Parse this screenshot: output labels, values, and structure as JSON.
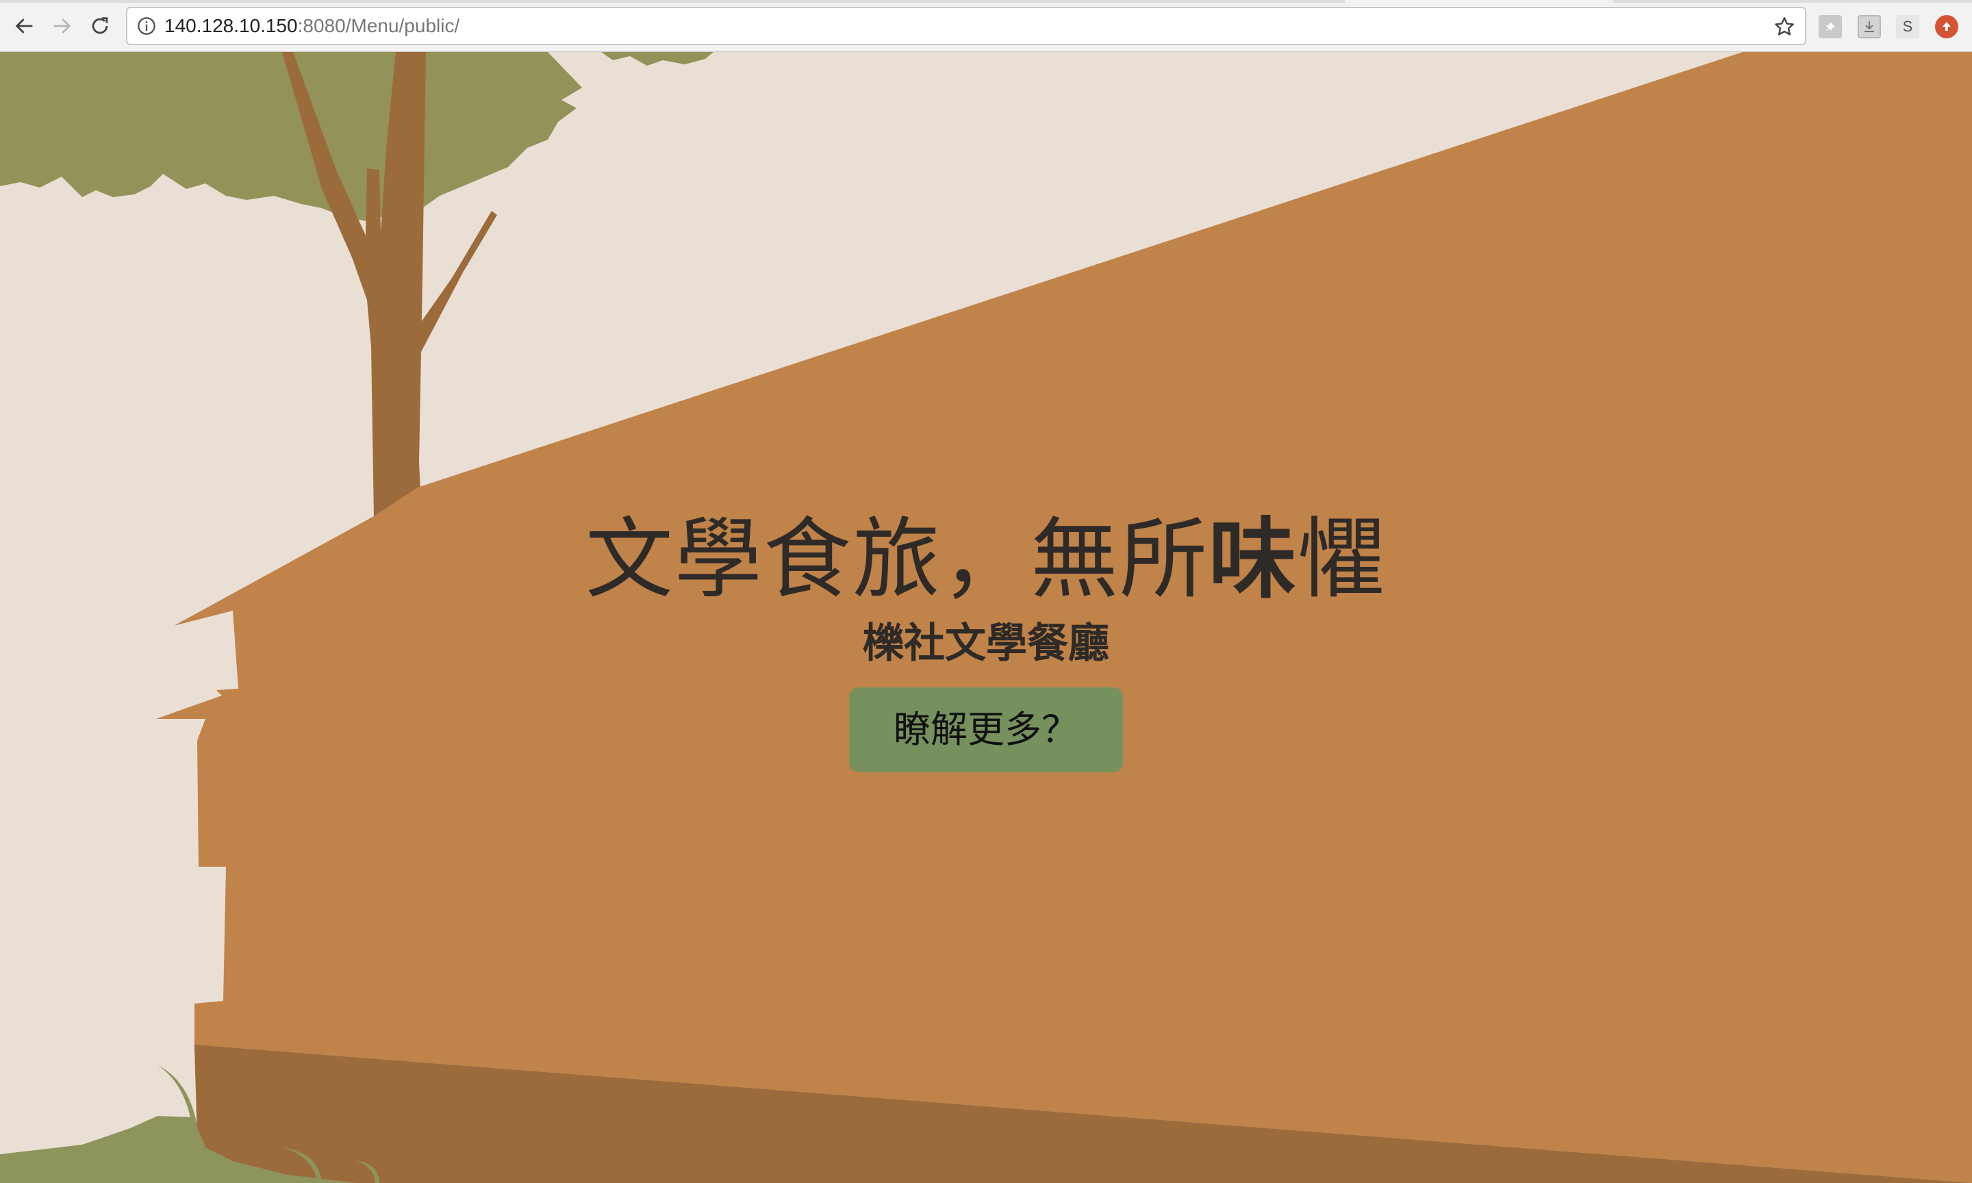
{
  "browser": {
    "url_host": "140.128.10.150",
    "url_rest": ":8080/Menu/public/",
    "icons": {
      "back": "arrow-left-icon",
      "forward": "arrow-right-icon",
      "reload": "reload-icon",
      "info": "info-icon",
      "bookmark": "star-icon",
      "ext1": "pin-extension-icon",
      "ext2": "download-extension-icon",
      "ext3": "s-extension-icon",
      "ext4": "red-upload-extension-icon"
    },
    "ext3_label": "S"
  },
  "hero": {
    "title_part1": "文學食旅，無所",
    "title_emphasis": "味",
    "title_part2": "懼",
    "subtitle": "櫟社文學餐廳",
    "button_label": "瞭解更多？"
  },
  "colors": {
    "background": "#eadfd5",
    "building": "#c08349",
    "building_shadow": "#9b6b3c",
    "tree_leaves": "#929259",
    "tree_trunk": "#9c6b3c",
    "grass": "#8e955c",
    "button": "#76915e",
    "text": "#2e2a27"
  }
}
